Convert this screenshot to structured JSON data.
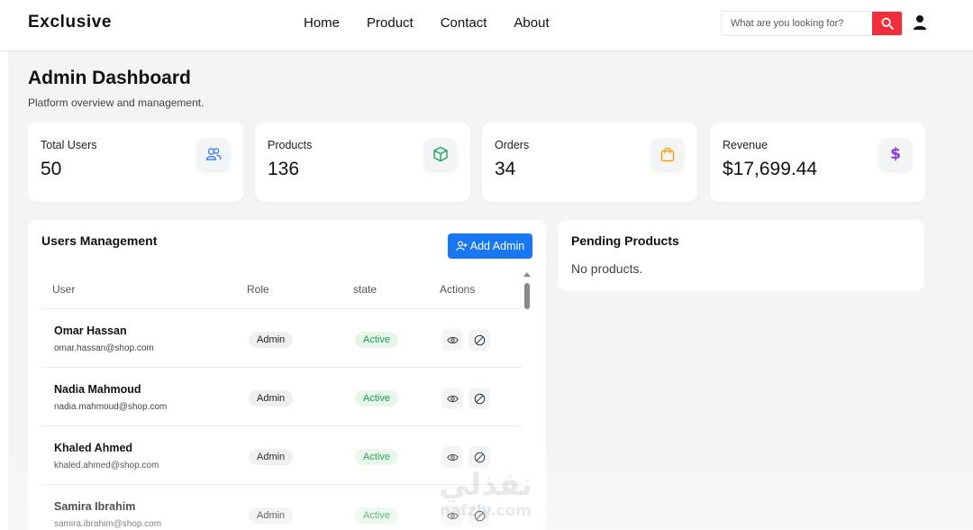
{
  "header": {
    "logo": "Exclusive",
    "nav": [
      "Home",
      "Product",
      "Contact",
      "About"
    ],
    "search_placeholder": "What are you looking for?"
  },
  "page": {
    "title": "Admin Dashboard",
    "subtitle": "Platform overview and management."
  },
  "stats": [
    {
      "label": "Total Users",
      "value": "50",
      "icon": "users-icon",
      "color": "#3b82f6"
    },
    {
      "label": "Products",
      "value": "136",
      "icon": "box-icon",
      "color": "#22a35a"
    },
    {
      "label": "Orders",
      "value": "34",
      "icon": "shopping-bag-icon",
      "color": "#f59e0b"
    },
    {
      "label": "Revenue",
      "value": "$17,699.44",
      "icon": "dollar-icon",
      "color": "#9333ea"
    }
  ],
  "users": {
    "title": "Users Management",
    "add_label": "Add Admin",
    "columns": [
      "User",
      "Role",
      "state",
      "Actions"
    ],
    "rows": [
      {
        "name": "Omar Hassan",
        "email": "omar.hassan@shop.com",
        "role": "Admin",
        "state": "Active"
      },
      {
        "name": "Nadia Mahmoud",
        "email": "nadia.mahmoud@shop.com",
        "role": "Admin",
        "state": "Active"
      },
      {
        "name": "Khaled Ahmed",
        "email": "khaled.ahmed@shop.com",
        "role": "Admin",
        "state": "Active"
      },
      {
        "name": "Samira Ibrahim",
        "email": "samira.ibrahim@shop.com",
        "role": "Admin",
        "state": "Active"
      }
    ]
  },
  "pending": {
    "title": "Pending Products",
    "empty_text": "No products."
  },
  "watermark": {
    "text_top": "نفذلي",
    "text_bottom": "nafzly.com"
  },
  "colors": {
    "accent": "#1877f2",
    "search_button": "#ef2d3b",
    "active_text": "#1f9d4a",
    "active_bg": "#e7f6ea"
  }
}
